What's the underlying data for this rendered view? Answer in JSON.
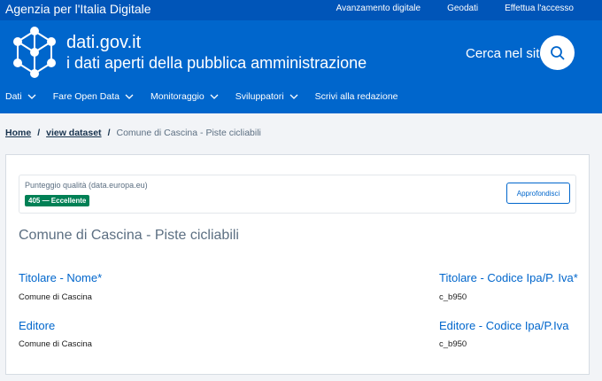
{
  "topbar": {
    "agency": "Agenzia per l'Italia Digitale",
    "links": [
      "Avanzamento digitale",
      "Geodati",
      "Effettua l'accesso"
    ]
  },
  "header": {
    "title": "dati.gov.it",
    "subtitle": "i dati aperti della pubblica amministrazione",
    "search_label": "Cerca nel sito",
    "logo_icon": "dati-network-logo",
    "search_icon": "search-icon"
  },
  "nav": {
    "items": [
      {
        "label": "Dati",
        "dropdown": true
      },
      {
        "label": "Fare Open Data",
        "dropdown": true
      },
      {
        "label": "Monitoraggio",
        "dropdown": true
      },
      {
        "label": "Sviluppatori",
        "dropdown": true
      },
      {
        "label": "Scrivi alla redazione",
        "dropdown": false
      }
    ]
  },
  "breadcrumb": {
    "home": "Home",
    "sep": "/",
    "view": "view dataset",
    "current": "Comune di Cascina - Piste cicliabili"
  },
  "quality": {
    "label": "Punteggio qualità (data.europa.eu)",
    "badge": "405 — Eccellente",
    "button": "Approfondisci"
  },
  "dataset": {
    "title": "Comune di Cascina - Piste cicliabili",
    "fields": [
      {
        "label": "Titolare - Nome*",
        "value": "Comune di Cascina"
      },
      {
        "label": "Titolare - Codice Ipa/P. Iva*",
        "value": "c_b950"
      },
      {
        "label": "Editore",
        "value": "Comune di Cascina"
      },
      {
        "label": "Editore - Codice Ipa/P.Iva",
        "value": "c_b950"
      }
    ]
  },
  "colors": {
    "topbar": "#0055b8",
    "header": "#0066cc",
    "badge": "#008055",
    "link": "#0066cc"
  }
}
